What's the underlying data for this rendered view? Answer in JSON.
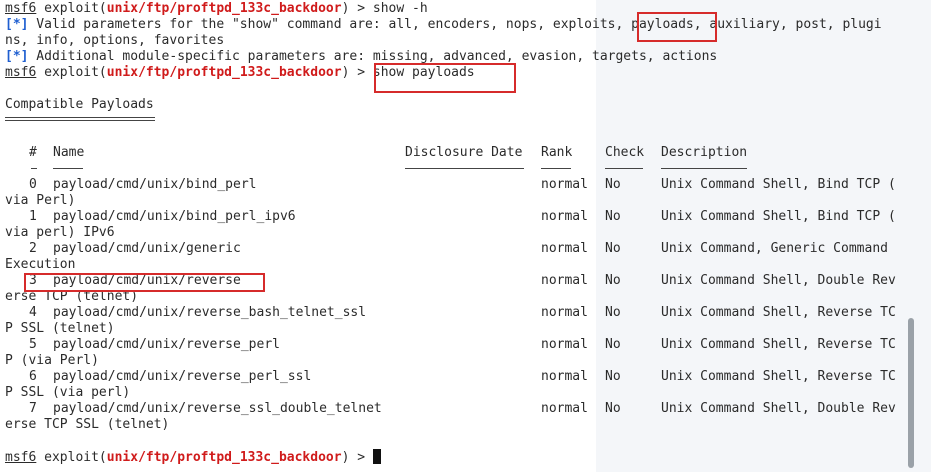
{
  "prompt": {
    "user": "msf6",
    "word_exploit": "exploit(",
    "module": "unix/ftp/proftpd_133c_backdoor",
    "suffix": ") > "
  },
  "commands": {
    "first": "show -h",
    "second": "show payloads"
  },
  "info_marker": "[*]",
  "help_lines": [
    " Valid parameters for the \"show\" command are: all, encoders, nops, exploits, payloads, auxiliary, post, plugi",
    "ns, info, options, favorites",
    " Additional module-specific parameters are: missing, advanced, evasion, targets, actions"
  ],
  "section_title": "Compatible Payloads",
  "columns": {
    "num": "#",
    "name": "Name",
    "date": "Disclosure Date",
    "rank": "Rank",
    "check": "Check",
    "desc": "Description"
  },
  "rows": [
    {
      "num": "0",
      "name": "payload/cmd/unix/bind_perl",
      "rank": "normal",
      "check": "No",
      "desc": "Unix Command Shell, Bind TCP (",
      "wrap": "via Perl)"
    },
    {
      "num": "1",
      "name": "payload/cmd/unix/bind_perl_ipv6",
      "rank": "normal",
      "check": "No",
      "desc": "Unix Command Shell, Bind TCP (",
      "wrap": "via perl) IPv6"
    },
    {
      "num": "2",
      "name": "payload/cmd/unix/generic",
      "rank": "normal",
      "check": "No",
      "desc": "Unix Command, Generic Command",
      "wrap": "Execution"
    },
    {
      "num": "3",
      "name": "payload/cmd/unix/reverse",
      "rank": "normal",
      "check": "No",
      "desc": "Unix Command Shell, Double Rev",
      "wrap": "erse TCP (telnet)"
    },
    {
      "num": "4",
      "name": "payload/cmd/unix/reverse_bash_telnet_ssl",
      "rank": "normal",
      "check": "No",
      "desc": "Unix Command Shell, Reverse TC",
      "wrap": "P SSL (telnet)"
    },
    {
      "num": "5",
      "name": "payload/cmd/unix/reverse_perl",
      "rank": "normal",
      "check": "No",
      "desc": "Unix Command Shell, Reverse TC",
      "wrap": "P (via Perl)"
    },
    {
      "num": "6",
      "name": "payload/cmd/unix/reverse_perl_ssl",
      "rank": "normal",
      "check": "No",
      "desc": "Unix Command Shell, Reverse TC",
      "wrap": "P SSL (via perl)"
    },
    {
      "num": "7",
      "name": "payload/cmd/unix/reverse_ssl_double_telnet",
      "rank": "normal",
      "check": "No",
      "desc": "Unix Command Shell, Double Rev",
      "wrap": "erse TCP SSL (telnet)"
    }
  ],
  "colors": {
    "module": "#d01b1b",
    "info": "#1f5fd0",
    "highlight": "#d62b2b"
  }
}
